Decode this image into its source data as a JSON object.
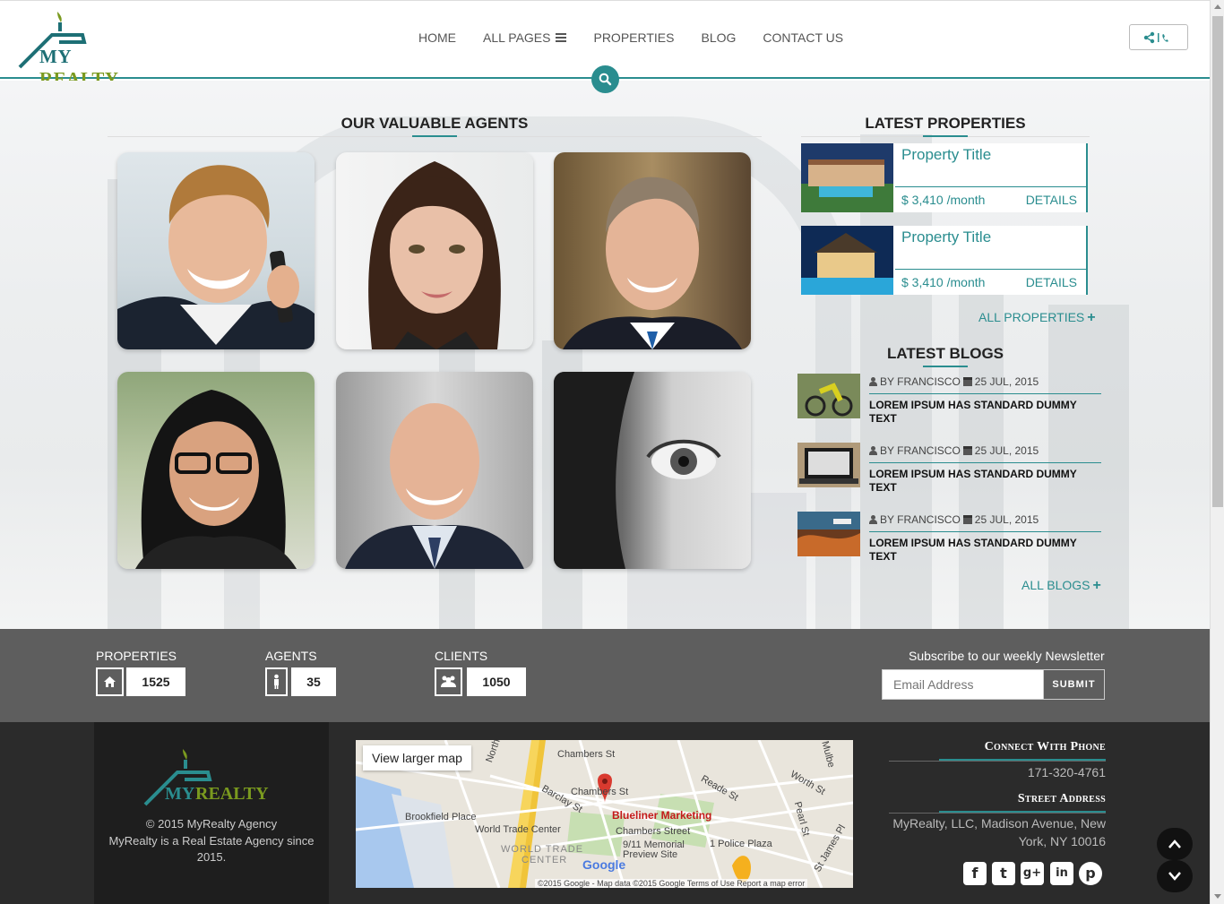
{
  "header": {
    "logo_my": "MY",
    "logo_realty": "REALTY",
    "nav": [
      "HOME",
      "ALL PAGES",
      "PROPERTIES",
      "BLOG",
      "CONTACT US"
    ],
    "contact_button": "<|"
  },
  "agents": {
    "title": "OUR VALUABLE AGENTS"
  },
  "properties": {
    "title": "LATEST PROPERTIES",
    "items": [
      {
        "title": "Property Title",
        "price": "$ 3,410 /month",
        "details": "DETAILS"
      },
      {
        "title": "Property Title",
        "price": "$ 3,410 /month",
        "details": "DETAILS"
      }
    ],
    "all_link": "ALL PROPERTIES"
  },
  "blogs": {
    "title": "LATEST BLOGS",
    "items": [
      {
        "author": "BY FRANCISCO",
        "date": "25 JUL, 2015",
        "title": "LOREM IPSUM HAS STANDARD DUMMY TEXT"
      },
      {
        "author": "BY FRANCISCO",
        "date": "25 JUL, 2015",
        "title": "LOREM IPSUM HAS STANDARD DUMMY TEXT"
      },
      {
        "author": "BY FRANCISCO",
        "date": "25 JUL, 2015",
        "title": "LOREM IPSUM HAS STANDARD DUMMY TEXT"
      }
    ],
    "all_link": "ALL BLOGS"
  },
  "stats": {
    "properties_label": "PROPERTIES",
    "properties_value": "1525",
    "agents_label": "AGENTS",
    "agents_value": "35",
    "clients_label": "CLIENTS",
    "clients_value": "1050"
  },
  "newsletter": {
    "label": "Subscribe to our weekly Newsletter",
    "placeholder": "Email Address",
    "submit": "SUBMIT"
  },
  "footer": {
    "copyright": "© 2015 MyRealty Agency",
    "about_line1": "MyRealty is a Real Estate Agency since",
    "about_line2": "2015.",
    "map_button": "View larger map",
    "map_labels": {
      "chambers_st_top": "Chambers St",
      "chambers_st_mid": "Chambers St",
      "chambers_street": "Chambers Street",
      "marker": "Blueliner Marketing",
      "brookfield": "Brookfield Place",
      "wtc": "World Trade Center",
      "wtc_area1": "WORLD TRADE",
      "wtc_area2": "CENTER",
      "memorial1": "9/11 Memorial",
      "memorial2": "Preview Site",
      "police": "1 Police Plaza",
      "barclay": "Barclay St",
      "reade": "Reade St",
      "worth": "Worth St",
      "pearl": "Pearl St",
      "james": "St James Pl",
      "north": "North",
      "mulb": "Mulbe",
      "google": "Google",
      "footer": "©2015 Google - Map data ©2015 Google   Terms of Use   Report a map error"
    },
    "phone_heading": "Connect With Phone",
    "phone": "171-320-4761",
    "address_heading": "Street Address",
    "address_line1": "MyRealty, LLC, Madison Avenue, New",
    "address_line2": "York, NY 10016",
    "social": [
      "facebook",
      "twitter",
      "google-plus",
      "linkedin",
      "pinterest"
    ],
    "social_glyphs": [
      "f",
      "t",
      "g+",
      "in",
      "p"
    ]
  },
  "colors": {
    "accent": "#2a8d8f",
    "logo_green": "#7a9a1f",
    "stats_bg": "#5e5e5e",
    "footer_bg": "#2b2b2b"
  }
}
